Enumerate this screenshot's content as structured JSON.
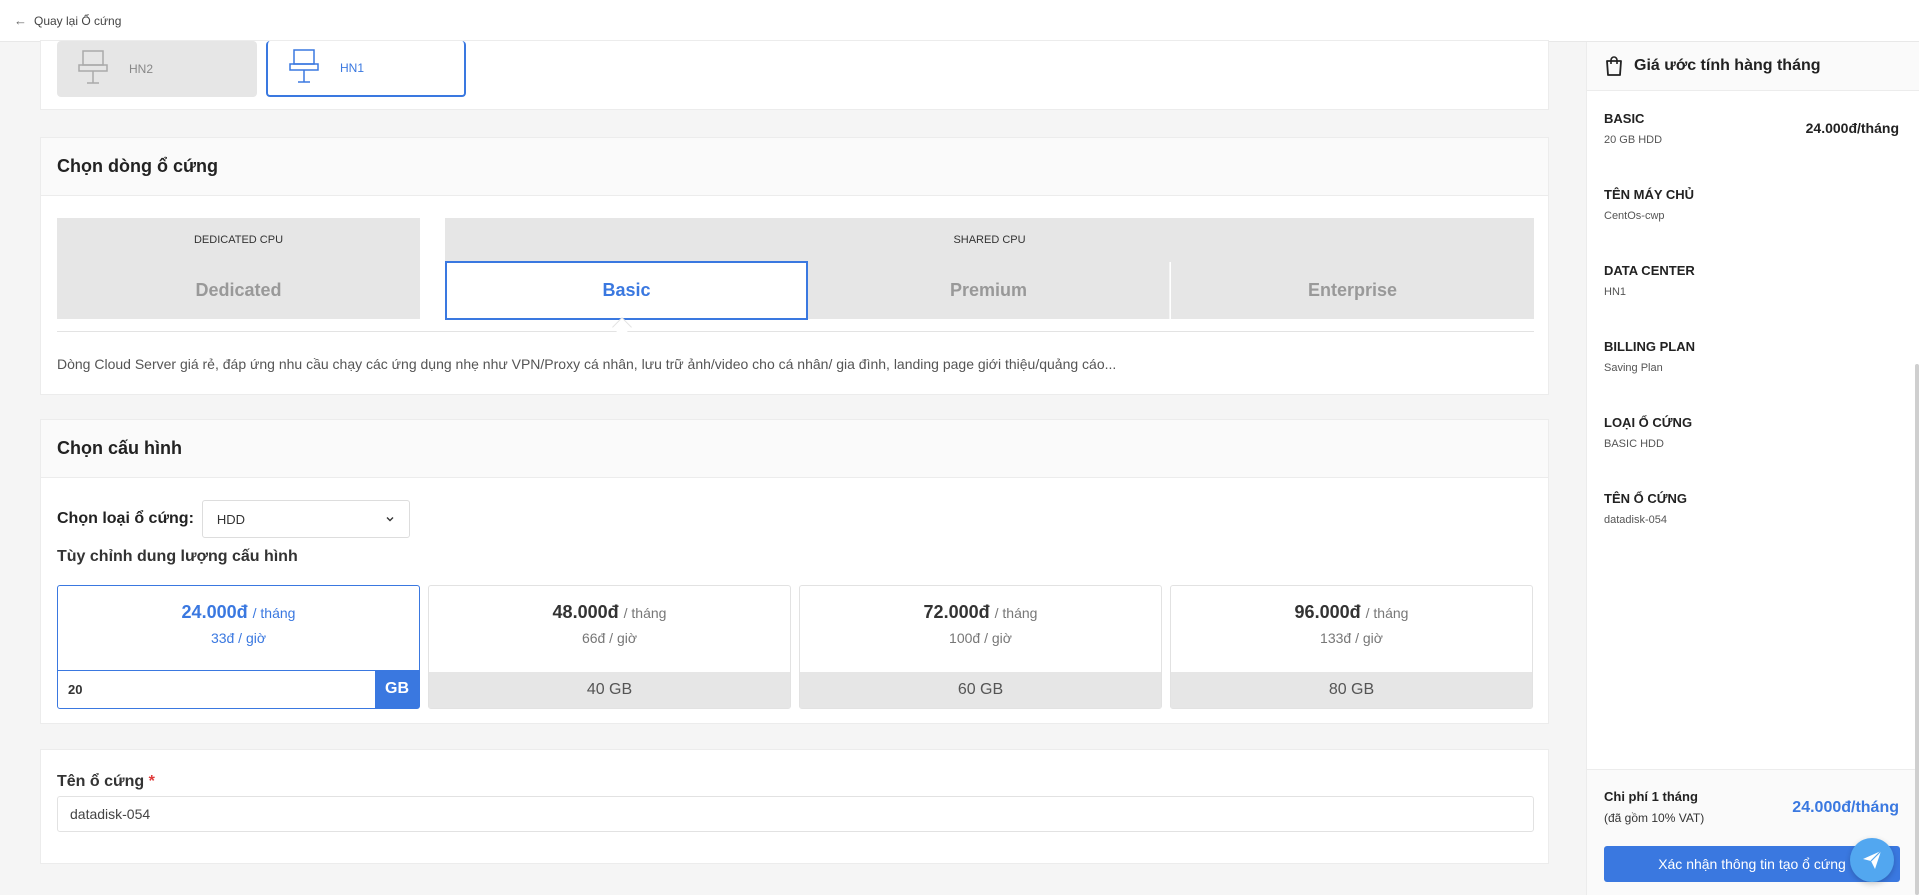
{
  "topbar": {
    "back_label": "Quay lại Ổ cứng"
  },
  "datacenter": {
    "options": [
      {
        "label": "HN2",
        "selected": false
      },
      {
        "label": "HN1",
        "selected": true
      }
    ]
  },
  "disk_line": {
    "title": "Chọn dòng ổ cứng",
    "groups": {
      "dedicated": "DEDICATED CPU",
      "shared": "SHARED CPU"
    },
    "options": [
      "Dedicated",
      "Basic",
      "Premium",
      "Enterprise"
    ],
    "selected": "Basic",
    "description": "Dòng Cloud Server giá rẻ, đáp ứng nhu cầu chạy các ứng dụng nhẹ như VPN/Proxy cá nhân, lưu trữ ảnh/video cho cá nhân/ gia đình, landing page giới thiệu/quảng cáo..."
  },
  "config": {
    "title": "Chọn cấu hình",
    "disk_type_label": "Chọn loại ổ cứng:",
    "disk_type_value": "HDD",
    "custom_label": "Tùy chỉnh dung lượng cấu hình",
    "month_unit": "/ tháng",
    "plans": [
      {
        "price": "24.000đ",
        "hour": "33đ / giờ",
        "size": "20",
        "unit": "GB",
        "selected": true
      },
      {
        "price": "48.000đ",
        "hour": "66đ / giờ",
        "size": "40 GB",
        "selected": false
      },
      {
        "price": "72.000đ",
        "hour": "100đ / giờ",
        "size": "60 GB",
        "selected": false
      },
      {
        "price": "96.000đ",
        "hour": "133đ / giờ",
        "size": "80 GB",
        "selected": false
      }
    ]
  },
  "disk_name": {
    "label": "Tên ổ cứng",
    "required_mark": "*",
    "value": "datadisk-054"
  },
  "summary": {
    "title": "Giá ước tính hàng tháng",
    "items": [
      {
        "key": "BASIC",
        "value": "20 GB HDD"
      },
      {
        "key": "TÊN MÁY CHỦ",
        "value": "CentOs-cwp"
      },
      {
        "key": "DATA CENTER",
        "value": "HN1"
      },
      {
        "key": "BILLING PLAN",
        "value": "Saving Plan"
      },
      {
        "key": "LOẠI Ổ CỨNG",
        "value": "BASIC HDD"
      },
      {
        "key": "TÊN Ổ CỨNG",
        "value": "datadisk-054"
      }
    ],
    "basic_price": "24.000đ/tháng",
    "monthly_label": "Chi phí 1 tháng",
    "vat_note": "(đã gồm 10% VAT)",
    "monthly_price": "24.000đ/tháng",
    "confirm_label": "Xác nhận thông tin tạo ổ cứng"
  },
  "colors": {
    "accent": "#3a78e0",
    "required": "#e03a3a",
    "fab": "#52a7f0"
  },
  "icons": [
    "arrow-left-icon",
    "server-icon",
    "shopping-bag-icon",
    "chevron-down-icon",
    "send-icon"
  ]
}
